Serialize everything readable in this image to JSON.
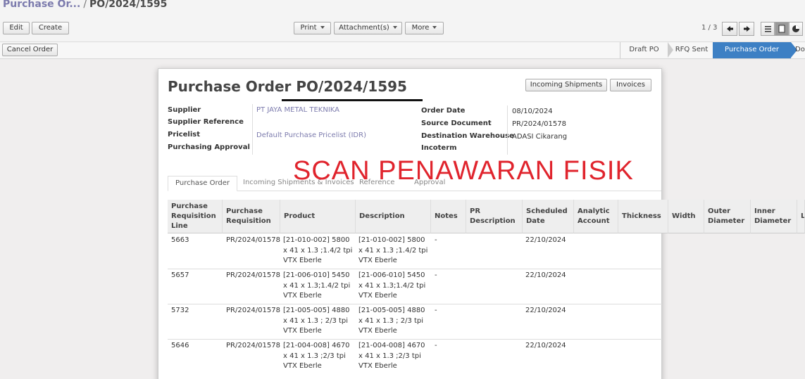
{
  "breadcrumb": {
    "parent": "Purchase Or...",
    "separator": "/",
    "current": "PO/2024/1595"
  },
  "toolbar": {
    "edit": "Edit",
    "create": "Create",
    "print": "Print",
    "attachments": "Attachment(s)",
    "more": "More"
  },
  "pager": {
    "text": "1 / 3"
  },
  "status": {
    "cancel": "Cancel Order",
    "stages": [
      "Draft PO",
      "RFQ Sent",
      "Purchase Order",
      "Do"
    ],
    "active_stage": "Purchase Order"
  },
  "form": {
    "title_prefix": "Purchase Order",
    "title_number": "PO/2024/1595",
    "buttons": {
      "incoming": "Incoming Shipments",
      "invoices": "Invoices"
    },
    "left_fields": [
      {
        "label": "Supplier",
        "value": "PT JAYA METAL TEKNIKA"
      },
      {
        "label": "Supplier Reference",
        "value": ""
      },
      {
        "label": "Pricelist",
        "value": "Default Purchase Pricelist (IDR)"
      },
      {
        "label": "Purchasing Approval",
        "value": ""
      }
    ],
    "right_fields": [
      {
        "label": "Order Date",
        "value": "08/10/2024"
      },
      {
        "label": "Source Document",
        "value": "PR/2024/01578"
      },
      {
        "label": "Destination Warehouse",
        "value": "ADASI Cikarang"
      },
      {
        "label": "Incoterm",
        "value": ""
      }
    ],
    "tabs": [
      "Purchase Order",
      "Incoming Shipments & Invoices",
      "Reference",
      "Approval"
    ],
    "stamp": "SCAN PENAWARAN FISIK"
  },
  "table": {
    "headers": [
      "Purchase Requisition Line",
      "Purchase Requisition",
      "Product",
      "Description",
      "Notes",
      "PR Description",
      "Scheduled Date",
      "Analytic Account",
      "Thickness",
      "Width",
      "Outer Diameter",
      "Inner Diameter",
      "L"
    ],
    "rows": [
      {
        "line": "5663",
        "req": "PR/2024/01578",
        "product": "[21-010-002] 5800 x 41 x 1.3 ;1.4/2 tpi VTX Eberle",
        "description": "[21-010-002] 5800 x 41 x 1.3 ;1.4/2 tpi VTX Eberle",
        "notes": "-",
        "date": "22/10/2024"
      },
      {
        "line": "5657",
        "req": "PR/2024/01578",
        "product": "[21-006-010] 5450 x 41 x 1.3;1.4/2 tpi VTX Eberle",
        "description": "[21-006-010] 5450 x 41 x 1.3;1.4/2 tpi VTX Eberle",
        "notes": "-",
        "date": "22/10/2024"
      },
      {
        "line": "5732",
        "req": "PR/2024/01578",
        "product": "[21-005-005] 4880 x 41 x 1.3 ; 2/3 tpi VTX Eberle",
        "description": "[21-005-005] 4880 x 41 x 1.3 ; 2/3 tpi VTX Eberle",
        "notes": "-",
        "date": "22/10/2024"
      },
      {
        "line": "5646",
        "req": "PR/2024/01578",
        "product": "[21-004-008] 4670 x 41 x 1.3 ;2/3 tpi VTX Eberle",
        "description": "[21-004-008] 4670 x 41 x 1.3 ;2/3 tpi VTX Eberle",
        "notes": "-",
        "date": "22/10/2024"
      }
    ]
  }
}
